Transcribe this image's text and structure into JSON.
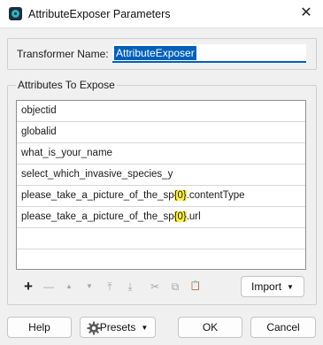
{
  "window": {
    "title": "AttributeExposer Parameters",
    "close_glyph": "✕"
  },
  "transformer": {
    "label": "Transformer Name:",
    "value": "AttributeExposer"
  },
  "attributes": {
    "group_title": "Attributes To Expose",
    "rows": [
      {
        "pre": "objectid",
        "hl": "",
        "post": ""
      },
      {
        "pre": "globalid",
        "hl": "",
        "post": ""
      },
      {
        "pre": "what_is_your_name",
        "hl": "",
        "post": ""
      },
      {
        "pre": "select_which_invasive_species_y",
        "hl": "",
        "post": ""
      },
      {
        "pre": "please_take_a_picture_of_the_sp",
        "hl": "{0}",
        "post": ".contentType"
      },
      {
        "pre": "please_take_a_picture_of_the_sp",
        "hl": "{0}",
        "post": ".url"
      }
    ],
    "highlight_color": "#fff14d"
  },
  "toolbar": {
    "add_icon": "+",
    "remove_icon": "—",
    "move_up_icon": "▲",
    "move_down_icon": "▼",
    "move_top_icon": "⤒",
    "move_bottom_icon": "⤓",
    "cut_icon": "✂",
    "copy_icon": "⧉",
    "paste_icon": "📋",
    "import_label": "Import",
    "dropdown_glyph": "▼"
  },
  "footer": {
    "help_label": "Help",
    "presets_label": "Presets",
    "ok_label": "OK",
    "cancel_label": "Cancel"
  },
  "colors": {
    "accent": "#005fb8",
    "selection": "#0060b8"
  }
}
